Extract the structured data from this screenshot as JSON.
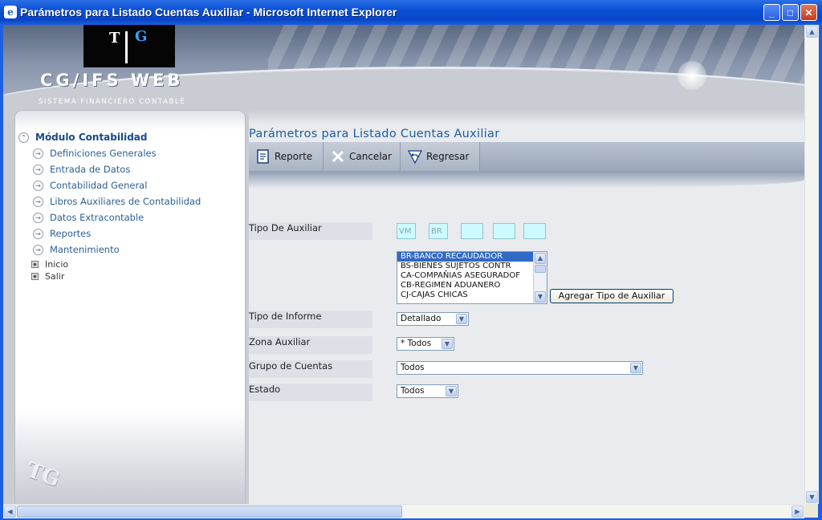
{
  "window": {
    "title": "Parámetros para Listado Cuentas Auxiliar - Microsoft Internet Explorer",
    "minimize_label": "_",
    "maximize_label": "□",
    "close_label": "✕"
  },
  "banner": {
    "logo_t": "T",
    "logo_g": "G",
    "app_name": "CG/IFS  WEB",
    "app_subtitle": "SISTEMA FINANCIERO CONTABLE"
  },
  "sidebar": {
    "header": "Módulo Contabilidad",
    "items": [
      {
        "label": "Definiciones Generales"
      },
      {
        "label": "Entrada de Datos"
      },
      {
        "label": "Contabilidad General"
      },
      {
        "label": "Libros Auxiliares de Contabilidad"
      },
      {
        "label": "Datos Extracontable"
      },
      {
        "label": "Reportes"
      },
      {
        "label": "Mantenimiento"
      }
    ],
    "links": [
      {
        "label": "Inicio"
      },
      {
        "label": "Salir"
      }
    ],
    "watermark": "TG"
  },
  "page": {
    "title": "Parámetros para Listado Cuentas Auxiliar"
  },
  "toolbar": {
    "report_label": "Reporte",
    "cancel_label": "Cancelar",
    "back_label": "Regresar"
  },
  "form": {
    "tipo_auxiliar_label": "Tipo De Auxiliar",
    "codes": [
      "VM",
      "BR",
      "",
      "",
      ""
    ],
    "aux_list": [
      {
        "text": "BR-BANCO RECAUDADOR",
        "selected": true
      },
      {
        "text": "BS-BIENES SUJETOS CONTR",
        "selected": false
      },
      {
        "text": "CA-COMPAÑIAS ASEGURADOF",
        "selected": false
      },
      {
        "text": "CB-REGIMEN ADUANERO",
        "selected": false
      },
      {
        "text": "CJ-CAJAS CHICAS",
        "selected": false
      }
    ],
    "add_button": "Agregar Tipo de Auxiliar",
    "tipo_informe_label": "Tipo de Informe",
    "tipo_informe_value": "Detallado",
    "zona_label": "Zona Auxiliar",
    "zona_value": "* Todos",
    "grupo_label": "Grupo de Cuentas",
    "grupo_value": "Todos",
    "estado_label": "Estado",
    "estado_value": "Todos"
  }
}
